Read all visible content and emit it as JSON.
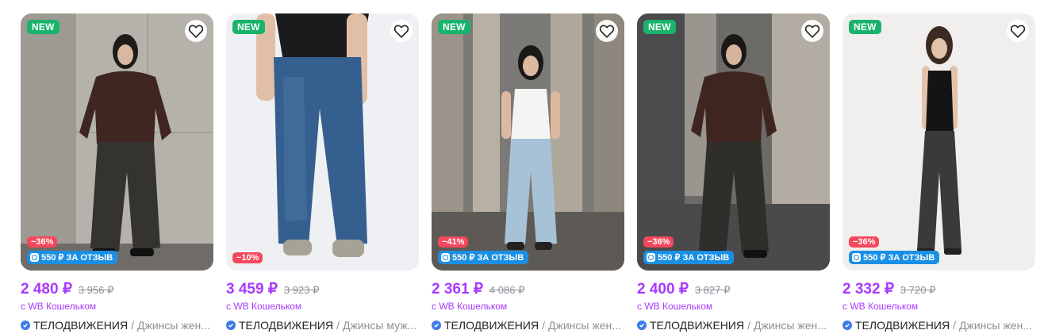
{
  "products": [
    {
      "new_badge": "NEW",
      "discount": "−36%",
      "review_bonus": "550 ₽ ЗА ОТЗЫВ",
      "price": "2 480 ₽",
      "old_price": "3 956 ₽",
      "wallet_note": "с WB Кошельком",
      "brand": "ТЕЛОДВИЖЕНИЯ",
      "separator": "/",
      "product_name": "Джинсы жен..."
    },
    {
      "new_badge": "NEW",
      "discount": "−10%",
      "review_bonus": "",
      "price": "3 459 ₽",
      "old_price": "3 923 ₽",
      "wallet_note": "с WB Кошельком",
      "brand": "ТЕЛОДВИЖЕНИЯ",
      "separator": "/",
      "product_name": "Джинсы муж..."
    },
    {
      "new_badge": "NEW",
      "discount": "−41%",
      "review_bonus": "550 ₽ ЗА ОТЗЫВ",
      "price": "2 361 ₽",
      "old_price": "4 086 ₽",
      "wallet_note": "с WB Кошельком",
      "brand": "ТЕЛОДВИЖЕНИЯ",
      "separator": "/",
      "product_name": "Джинсы жен..."
    },
    {
      "new_badge": "NEW",
      "discount": "−36%",
      "review_bonus": "550 ₽ ЗА ОТЗЫВ",
      "price": "2 400 ₽",
      "old_price": "3 827 ₽",
      "wallet_note": "с WB Кошельком",
      "brand": "ТЕЛОДВИЖЕНИЯ",
      "separator": "/",
      "product_name": "Джинсы жен..."
    },
    {
      "new_badge": "NEW",
      "discount": "−36%",
      "review_bonus": "550 ₽ ЗА ОТЗЫВ",
      "price": "2 332 ₽",
      "old_price": "3 720 ₽",
      "wallet_note": "с WB Кошельком",
      "brand": "ТЕЛОДВИЖЕНИЯ",
      "separator": "/",
      "product_name": "Джинсы жен..."
    }
  ],
  "colors": {
    "price": "#a73afd",
    "new_badge": "#19b36b",
    "discount": "#f5475c",
    "review": "#1a8fe3",
    "verified": "#3f7be8"
  },
  "icons": {
    "favorite": "heart-outline-icon",
    "verified": "verified-check-icon",
    "review": "wb-logo-icon"
  }
}
